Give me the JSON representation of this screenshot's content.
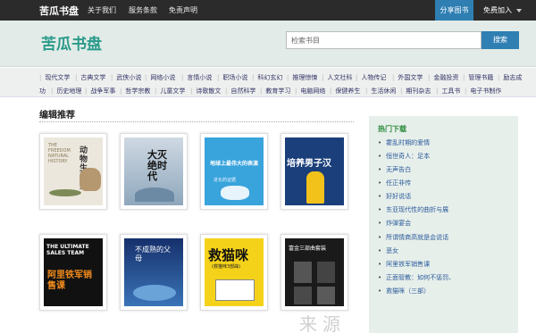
{
  "nav": {
    "brand": "苦瓜书盘",
    "links": [
      "关于我们",
      "服务条款",
      "免责声明"
    ],
    "share": "分享图书",
    "join": "免费加入"
  },
  "header": {
    "logo": "苦瓜书盘",
    "search_placeholder": "检索书目",
    "search_button": "搜索"
  },
  "categories": [
    "现代文学",
    "古典文学",
    "武侠小说",
    "网络小说",
    "言情小说",
    "职场小说",
    "科幻玄幻",
    "推理惊悚",
    "人文社科",
    "人物传记",
    "外国文学",
    "金融投资",
    "管理书籍",
    "励志成",
    "功",
    "历史地理",
    "战争军事",
    "哲学宗教",
    "儿童文学",
    "诗歌散文",
    "自然科学",
    "教育学习",
    "电脑网络",
    "保健养生",
    "生活休闲",
    "期刊杂志",
    "工具书",
    "电子书制作"
  ],
  "main": {
    "title": "编辑推荐",
    "books": [
      {
        "title": "动物生活史",
        "alt": "THE FREEDOM NATURAL HISTORY"
      },
      {
        "title": "大灭绝时代"
      },
      {
        "title": "地球上最伟大的表演",
        "alt": "进化的证据"
      },
      {
        "title": "培养男子汉"
      },
      {
        "title": "阿里铁军销售课",
        "alt": "THE ULTIMATE SALES TEAM"
      },
      {
        "title": "不成熟的父母"
      },
      {
        "title": "救猫咪",
        "alt": "(救猫咪3部曲)"
      },
      {
        "title": "富金三部曲套装"
      }
    ]
  },
  "sidebar": {
    "title": "热门下载",
    "items": [
      "霍乱时期的爱情",
      "恒世奇人：足本",
      "无声告白",
      "任正非传",
      "好好说话",
      "东亚现代性的曲折与展",
      "炸弹宴会",
      "所谓情商高就是会说话",
      "恶女",
      "阿里铁军销售课",
      "正面管教：如何不惩罚、",
      "救猫咪（三部）"
    ]
  },
  "watermark": "来源",
  "colors": {
    "nav_bg": "#2b2b2b",
    "accent_blue": "#2f7fb3",
    "logo_teal": "#2a9a8a",
    "header_bg": "#e2ebe7",
    "sidebar_bg": "#e7efeb",
    "hot_title_green": "#2a8a3a"
  }
}
